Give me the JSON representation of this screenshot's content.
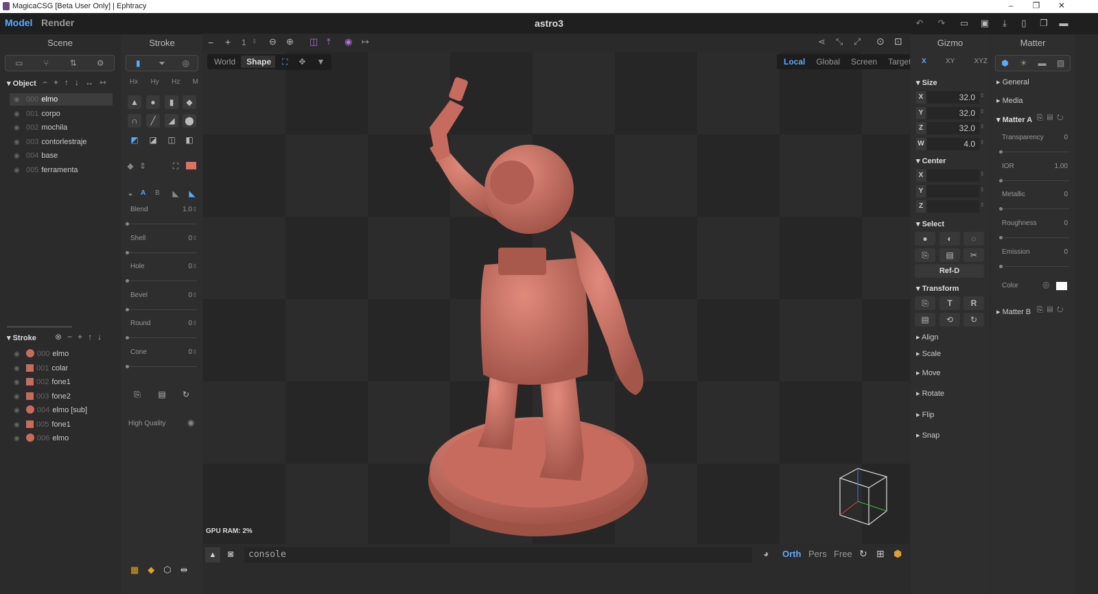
{
  "window": {
    "title": "MagicaCSG [Beta User Only] | Ephtracy",
    "min": "–",
    "max": "❐",
    "close": "✕"
  },
  "menu": {
    "model": "Model",
    "render": "Render",
    "doc": "astro3"
  },
  "scene": {
    "title": "Scene",
    "object_header": "Object",
    "objects": [
      {
        "idx": "000",
        "name": "elmo"
      },
      {
        "idx": "001",
        "name": "corpo"
      },
      {
        "idx": "002",
        "name": "mochila"
      },
      {
        "idx": "003",
        "name": "contorlestraje"
      },
      {
        "idx": "004",
        "name": "base"
      },
      {
        "idx": "005",
        "name": "ferramenta"
      }
    ],
    "stroke_header": "Stroke",
    "strokes": [
      {
        "idx": "000",
        "name": "elmo",
        "shape": "sphere"
      },
      {
        "idx": "001",
        "name": "colar",
        "shape": "cyl"
      },
      {
        "idx": "002",
        "name": "fone1",
        "shape": "cyl"
      },
      {
        "idx": "003",
        "name": "fone2",
        "shape": "cyl"
      },
      {
        "idx": "004",
        "name": "elmo [sub]",
        "shape": "sphere"
      },
      {
        "idx": "005",
        "name": "fone1",
        "shape": "cyl"
      },
      {
        "idx": "006",
        "name": "elmo",
        "shape": "sphere"
      }
    ]
  },
  "stroke": {
    "title": "Stroke",
    "mirror": [
      "Hx",
      "Hy",
      "Hz",
      "M"
    ],
    "ab": [
      "A",
      "B"
    ],
    "sliders": [
      {
        "label": "Blend",
        "value": "1.0"
      },
      {
        "label": "Shell",
        "value": "0"
      },
      {
        "label": "Hole",
        "value": "0"
      },
      {
        "label": "Bevel",
        "value": "0"
      },
      {
        "label": "Round",
        "value": "0"
      },
      {
        "label": "Cone",
        "value": "0"
      }
    ],
    "hq": "High Quality"
  },
  "viewport": {
    "num": "1",
    "world": "World",
    "shape": "Shape",
    "local": "Local",
    "global": "Global",
    "screen": "Screen",
    "target": "Target",
    "gpu": "GPU RAM:  2%"
  },
  "bottom": {
    "console": "console",
    "orth": "Orth",
    "pers": "Pers",
    "free": "Free"
  },
  "gizmo": {
    "title": "Gizmo",
    "tabs": [
      "X",
      "XY",
      "XYZ"
    ],
    "size": "Size",
    "size_fields": [
      {
        "l": "X",
        "v": "32.0"
      },
      {
        "l": "Y",
        "v": "32.0"
      },
      {
        "l": "Z",
        "v": "32.0"
      },
      {
        "l": "W",
        "v": "4.0"
      }
    ],
    "center": "Center",
    "center_fields": [
      {
        "l": "X",
        "v": ""
      },
      {
        "l": "Y",
        "v": ""
      },
      {
        "l": "Z",
        "v": ""
      }
    ],
    "select": "Select",
    "refd": "Ref-D",
    "transform": "Transform",
    "sections": [
      "Align",
      "Scale",
      "Move",
      "Rotate",
      "Flip",
      "Snap"
    ]
  },
  "matter": {
    "title": "Matter",
    "general": "General",
    "media": "Media",
    "matter_a": "Matter A",
    "matter_b": "Matter B",
    "props": [
      {
        "label": "Transparency",
        "value": "0"
      },
      {
        "label": "IOR",
        "value": "1.00"
      },
      {
        "label": "Metallic",
        "value": "0"
      },
      {
        "label": "Roughness",
        "value": "0"
      },
      {
        "label": "Emission",
        "value": "0"
      }
    ],
    "color": "Color"
  }
}
